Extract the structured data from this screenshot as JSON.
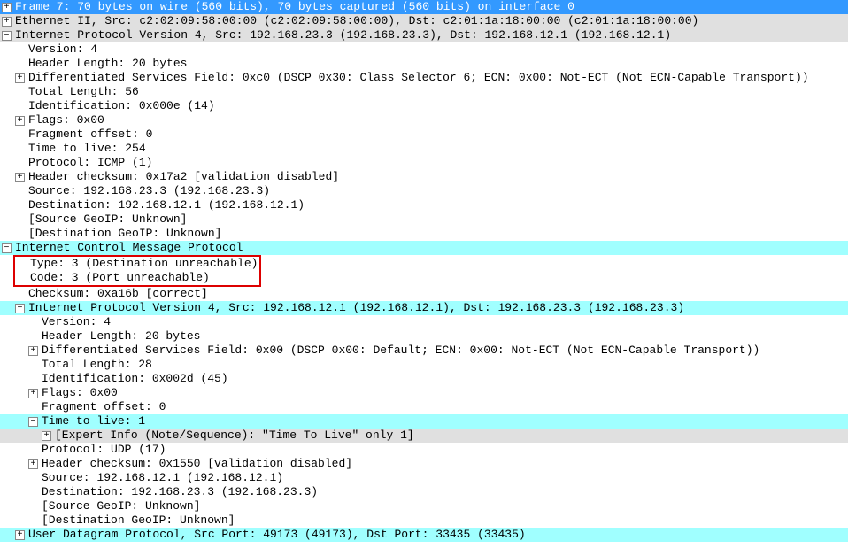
{
  "frame": {
    "title": "Frame 7: 70 bytes on wire (560 bits), 70 bytes captured (560 bits) on interface 0"
  },
  "eth": {
    "title": "Ethernet II, Src: c2:02:09:58:00:00 (c2:02:09:58:00:00), Dst: c2:01:1a:18:00:00 (c2:01:1a:18:00:00)"
  },
  "ip1": {
    "title": "Internet Protocol Version 4, Src: 192.168.23.3 (192.168.23.3), Dst: 192.168.12.1 (192.168.12.1)",
    "version": "Version: 4",
    "hlen": "Header Length: 20 bytes",
    "dsf": "Differentiated Services Field: 0xc0 (DSCP 0x30: Class Selector 6; ECN: 0x00: Not-ECT (Not ECN-Capable Transport))",
    "totlen": "Total Length: 56",
    "ident": "Identification: 0x000e (14)",
    "flags": "Flags: 0x00",
    "frag": "Fragment offset: 0",
    "ttl": "Time to live: 254",
    "proto": "Protocol: ICMP (1)",
    "hcsum": "Header checksum: 0x17a2 [validation disabled]",
    "src": "Source: 192.168.23.3 (192.168.23.3)",
    "dst": "Destination: 192.168.12.1 (192.168.12.1)",
    "srcgeo": "[Source GeoIP: Unknown]",
    "dstgeo": "[Destination GeoIP: Unknown]"
  },
  "icmp": {
    "title": "Internet Control Message Protocol",
    "type": "Type: 3 (Destination unreachable)",
    "code": "Code: 3 (Port unreachable)",
    "csum": "Checksum: 0xa16b [correct]"
  },
  "ip2": {
    "title": "Internet Protocol Version 4, Src: 192.168.12.1 (192.168.12.1), Dst: 192.168.23.3 (192.168.23.3)",
    "version": "Version: 4",
    "hlen": "Header Length: 20 bytes",
    "dsf": "Differentiated Services Field: 0x00 (DSCP 0x00: Default; ECN: 0x00: Not-ECT (Not ECN-Capable Transport))",
    "totlen": "Total Length: 28",
    "ident": "Identification: 0x002d (45)",
    "flags": "Flags: 0x00",
    "frag": "Fragment offset: 0",
    "ttl": "Time to live: 1",
    "expert": "[Expert Info (Note/Sequence): \"Time To Live\" only 1]",
    "proto": "Protocol: UDP (17)",
    "hcsum": "Header checksum: 0x1550 [validation disabled]",
    "src": "Source: 192.168.12.1 (192.168.12.1)",
    "dst": "Destination: 192.168.23.3 (192.168.23.3)",
    "srcgeo": "[Source GeoIP: Unknown]",
    "dstgeo": "[Destination GeoIP: Unknown]"
  },
  "udp": {
    "title": "User Datagram Protocol, Src Port: 49173 (49173), Dst Port: 33435 (33435)"
  },
  "glyph": {
    "plus": "+",
    "minus": "−"
  }
}
